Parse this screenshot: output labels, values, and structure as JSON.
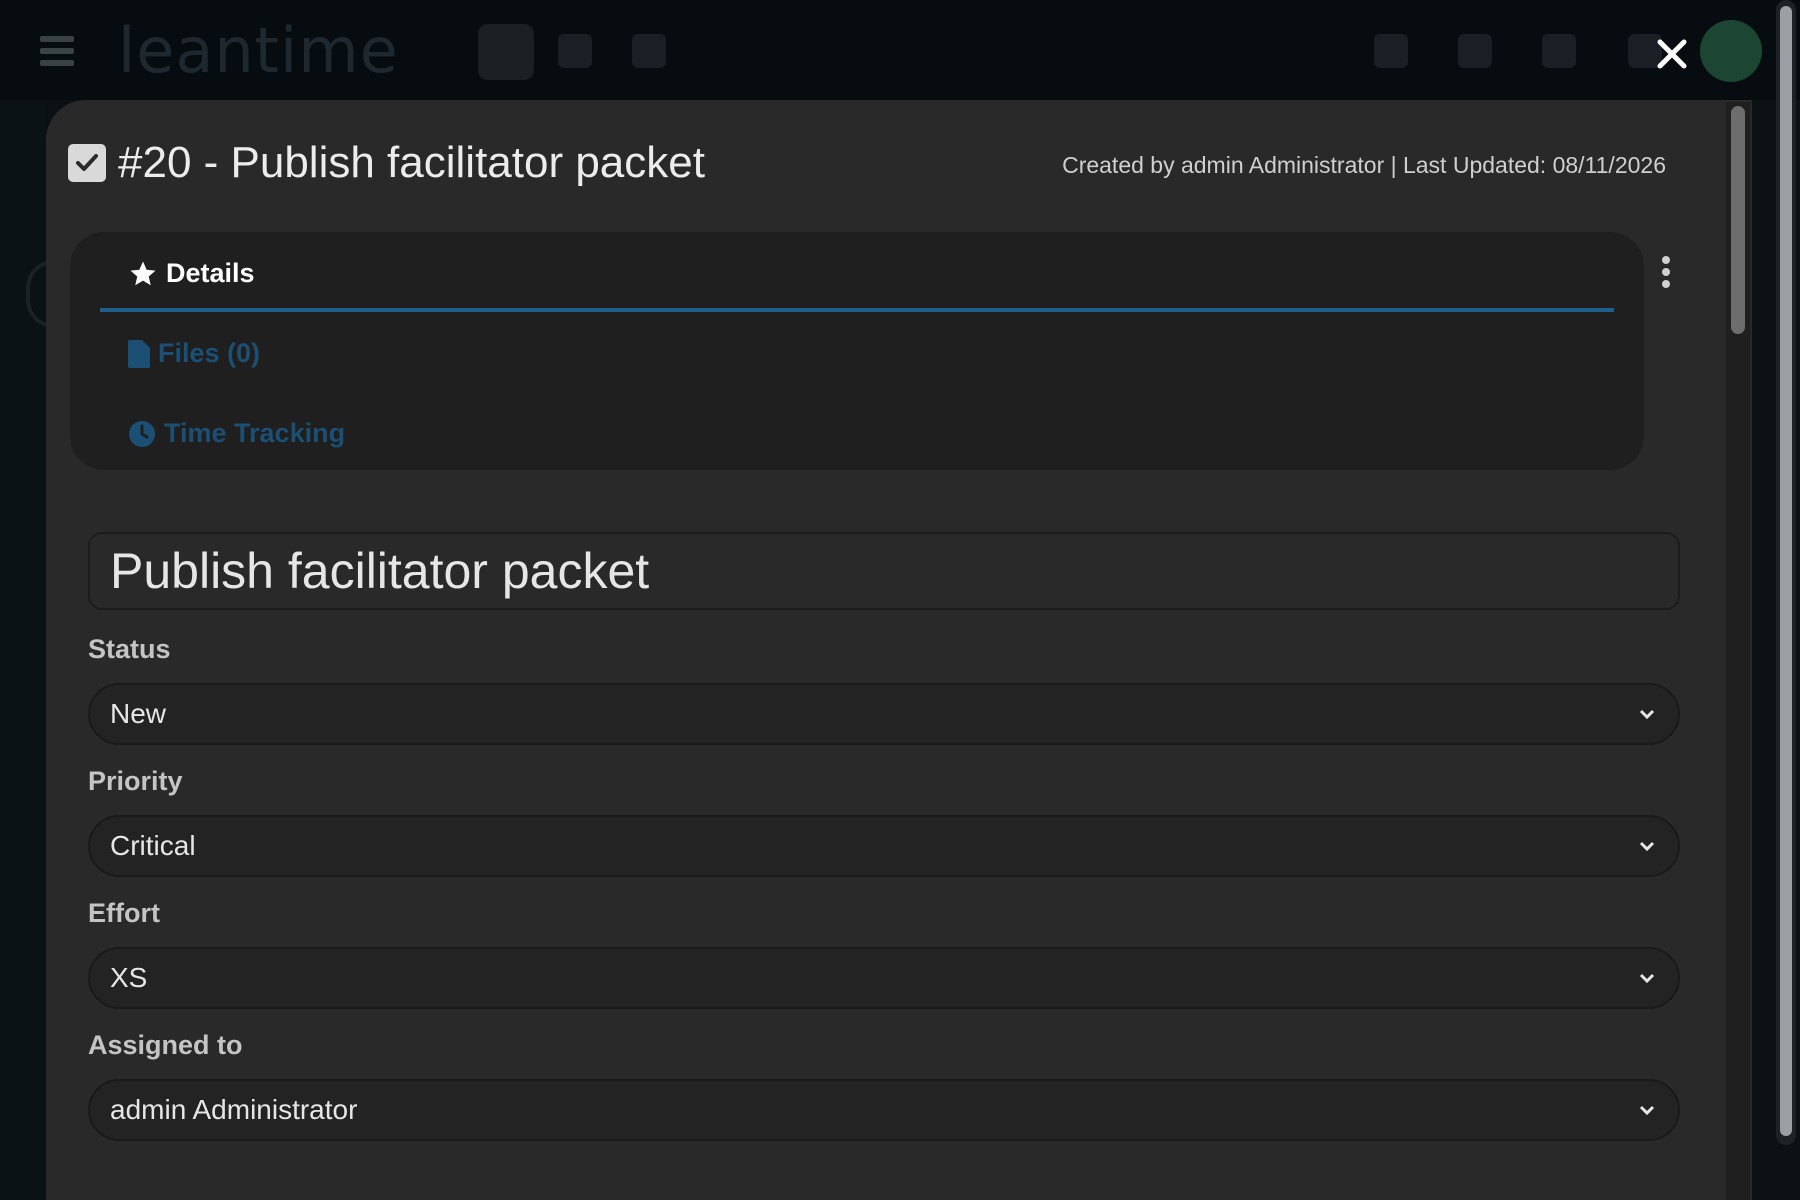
{
  "header": {
    "logo_text": "leantime"
  },
  "modal": {
    "title": "#20 - Publish facilitator packet",
    "meta": "Created by admin Administrator | Last Updated: 08/11/2026",
    "tabs": [
      {
        "label": "Details",
        "icon": "star-icon",
        "active": true
      },
      {
        "label": "Files (0)",
        "icon": "file-icon",
        "active": false
      },
      {
        "label": "Time Tracking",
        "icon": "clock-icon",
        "active": false
      }
    ],
    "title_input_value": "Publish facilitator packet",
    "fields": {
      "status": {
        "label": "Status",
        "value": "New"
      },
      "priority": {
        "label": "Priority",
        "value": "Critical"
      },
      "effort": {
        "label": "Effort",
        "value": "XS"
      },
      "assigned": {
        "label": "Assigned to",
        "value": "admin Administrator"
      }
    }
  },
  "colors": {
    "modal_bg": "#292929",
    "tab_active_underline": "#1e5f8c",
    "tab_inactive_text": "#1b4f73"
  }
}
